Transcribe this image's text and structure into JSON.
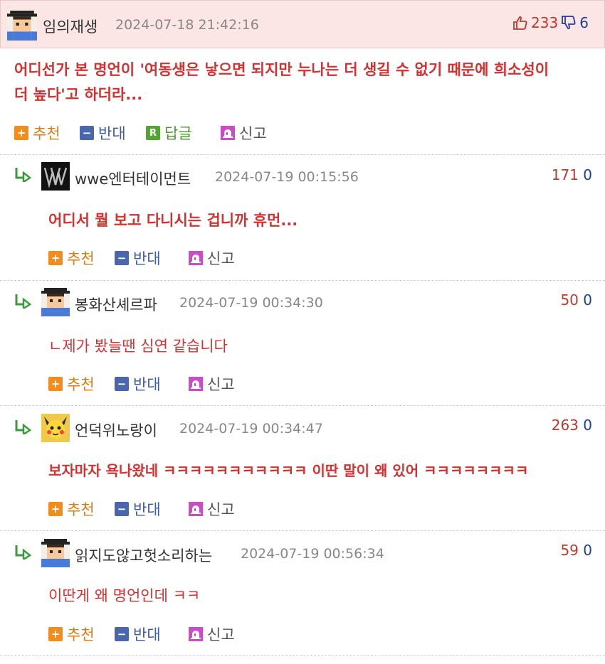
{
  "main_post": {
    "author": "임의재생",
    "datetime": "2024-07-18 21:42:16",
    "upvotes": "233",
    "downvotes": "6",
    "text_line1": "어디선가 본 명언이 '여동생은 낳으면 되지만 누나는 더 생길 수 없기 때문에 희소성이",
    "text_line2": "더 높다'고 하더라...",
    "actions": {
      "recommend": "추천",
      "oppose": "반대",
      "reply": "답글",
      "report": "신고"
    }
  },
  "replies": [
    {
      "author": "wwe엔터테이먼트",
      "datetime": "2024-07-19 00:15:56",
      "upvotes": "171",
      "downvotes": "0",
      "text": "어디서 뭘 보고 다니시는 겁니까 휴먼...",
      "actions": {
        "recommend": "추천",
        "oppose": "반대",
        "report": "신고"
      }
    },
    {
      "author": "봉화산셰르파",
      "datetime": "2024-07-19 00:34:30",
      "upvotes": "50",
      "downvotes": "0",
      "text": "ㄴ제가 봤늘땐 심연 같습니다",
      "actions": {
        "recommend": "추천",
        "oppose": "반대",
        "report": "신고"
      }
    },
    {
      "author": "언덕위노랑이",
      "datetime": "2024-07-19 00:34:47",
      "upvotes": "263",
      "downvotes": "0",
      "text": "보자마자 욕나왔네 ㅋㅋㅋㅋㅋㅋㅋㅋㅋㅋㅋ 이딴 말이 왜 있어 ㅋㅋㅋㅋㅋㅋㅋㅋ",
      "actions": {
        "recommend": "추천",
        "oppose": "반대",
        "report": "신고"
      }
    },
    {
      "author": "읽지도않고헛소리하는",
      "datetime": "2024-07-19 00:56:34",
      "upvotes": "59",
      "downvotes": "0",
      "text": "이딴게 왜 명언인데 ㅋㅋ",
      "actions": {
        "recommend": "추천",
        "oppose": "반대",
        "report": "신고"
      }
    }
  ],
  "colors": {
    "header_bg": "#fbe5e5",
    "comment_red": "#d63030",
    "upvote": "#c0392b",
    "downvote": "#1f3f9c"
  },
  "icons": {
    "thumb_up": "thumbs-up-icon",
    "thumb_down": "thumbs-down-icon",
    "reply_arrow": "reply-arrow-icon",
    "recommend": "plus-icon",
    "oppose": "minus-icon",
    "reply": "r-icon",
    "report": "siren-icon"
  }
}
